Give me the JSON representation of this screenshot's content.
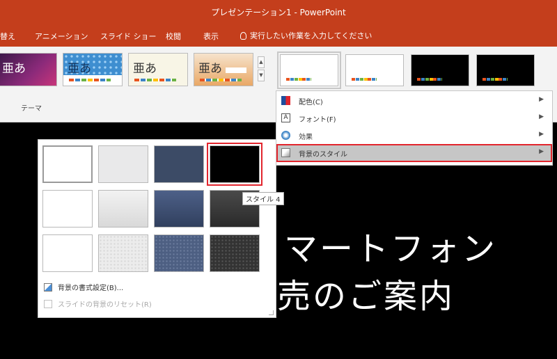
{
  "window": {
    "title": "プレゼンテーション1 - PowerPoint"
  },
  "tabs": [
    {
      "label": "画面切り替え",
      "visible_text": "替え"
    },
    {
      "label": "アニメーション"
    },
    {
      "label": "スライド ショー"
    },
    {
      "label": "校閲"
    },
    {
      "label": "表示"
    }
  ],
  "tell_me": {
    "placeholder": "実行したい作業を入力してください"
  },
  "themes_group": {
    "label": "テーマ",
    "themes": [
      {
        "glyph": "亜あ",
        "style": "purple"
      },
      {
        "glyph": "亜あ",
        "style": "blue-pattern"
      },
      {
        "glyph": "亜あ",
        "style": "cream"
      },
      {
        "glyph": "亜あ",
        "style": "orange"
      }
    ]
  },
  "variants": [
    {
      "style": "white-selected"
    },
    {
      "style": "white"
    },
    {
      "style": "black"
    },
    {
      "style": "black"
    }
  ],
  "variants_menu": {
    "items": [
      {
        "label": "配色(C)",
        "icon": "color-scheme-icon"
      },
      {
        "label": "フォント(F)",
        "icon": "font-icon"
      },
      {
        "label": "効果",
        "icon": "effects-icon"
      },
      {
        "label": "背景のスタイル",
        "icon": "background-style-icon",
        "highlighted": true
      }
    ]
  },
  "slide": {
    "line1": "マートフォン",
    "line2": "売のご案内"
  },
  "background_styles": {
    "selected": "スタイル 4",
    "tooltip": "スタイル 4",
    "actions": [
      {
        "label": "背景の書式設定(B)...",
        "enabled": true
      },
      {
        "label": "スライドの背景のリセット(R)",
        "enabled": false
      }
    ]
  },
  "colors": {
    "accent": "#c43e1c",
    "highlight_border": "#e2252d"
  }
}
